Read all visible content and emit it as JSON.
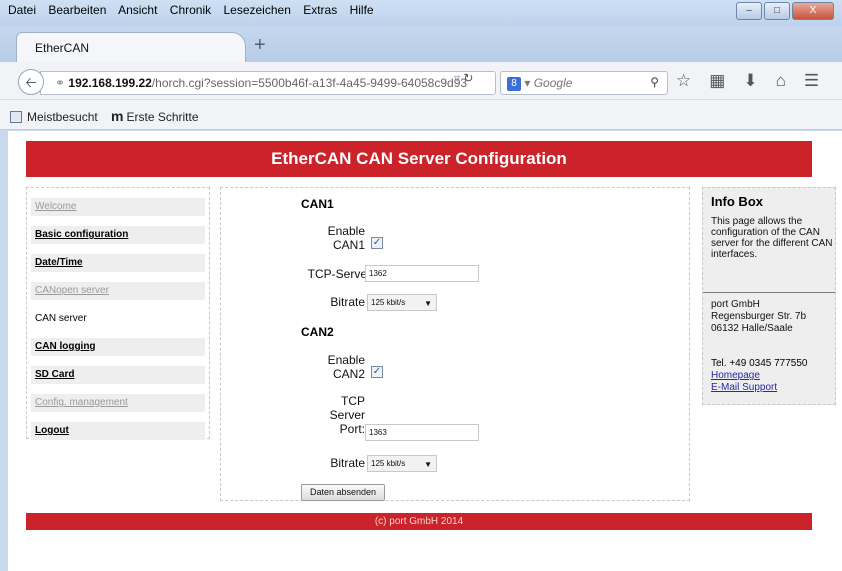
{
  "browser": {
    "menu": [
      "Datei",
      "Bearbeiten",
      "Ansicht",
      "Chronik",
      "Lesezeichen",
      "Extras",
      "Hilfe"
    ],
    "window_buttons": {
      "minimize": "–",
      "maximize": "□",
      "close": "X"
    },
    "tab_title": "EtherCAN",
    "new_tab_glyph": "+",
    "url_host": "192.168.199.22",
    "url_rest": "/horch.cgi?session=5500b46f-a13f-4a45-9499-64058c9d93",
    "search_engine_glyph": "8",
    "search_placeholder": "Google",
    "bookmarks": [
      "Meistbesucht",
      "Erste Schritte"
    ],
    "bookmark_m_glyph": "m"
  },
  "page": {
    "header_title": "EtherCAN CAN Server Configuration",
    "nav": [
      {
        "label": "Welcome",
        "style": "grey"
      },
      {
        "label": "Basic configuration",
        "style": "link"
      },
      {
        "label": "Date/Time",
        "style": "link"
      },
      {
        "label": "CANopen server",
        "style": "grey"
      },
      {
        "label": "CAN server",
        "style": "plain"
      },
      {
        "label": "CAN logging",
        "style": "link"
      },
      {
        "label": "SD Card",
        "style": "link"
      },
      {
        "label": "Config. management",
        "style": "grey"
      },
      {
        "label": "Logout",
        "style": "link"
      }
    ],
    "can1": {
      "title": "CAN1",
      "enable_label_1": "Enable",
      "enable_label_2": "CAN1",
      "enabled": true,
      "tcp_label": "TCP-Server",
      "tcp_value": "1362",
      "bitrate_label": "Bitrate",
      "bitrate_value": "125 kbit/s"
    },
    "can2": {
      "title": "CAN2",
      "enable_label_1": "Enable",
      "enable_label_2": "CAN2",
      "enabled": true,
      "tcp_label_1": "TCP",
      "tcp_label_2": "Server",
      "tcp_label_3": "Port:",
      "tcp_value": "1363",
      "bitrate_label": "Bitrate",
      "bitrate_value": "125 kbit/s"
    },
    "submit_label": "Daten absenden",
    "infobox": {
      "title": "Info Box",
      "text": "This page allows the configuration of the CAN server for the different CAN interfaces.",
      "address_1": "port GmbH",
      "address_2": "Regensburger Str. 7b",
      "address_3": "06132 Halle/Saale",
      "tel": "Tel. +49 0345 777550",
      "link_homepage": "Homepage",
      "link_support": "E-Mail Support"
    },
    "footer": "(c) port GmbH 2014"
  },
  "colors": {
    "brand_red": "#cc2229",
    "link_blue": "#2727a8"
  }
}
